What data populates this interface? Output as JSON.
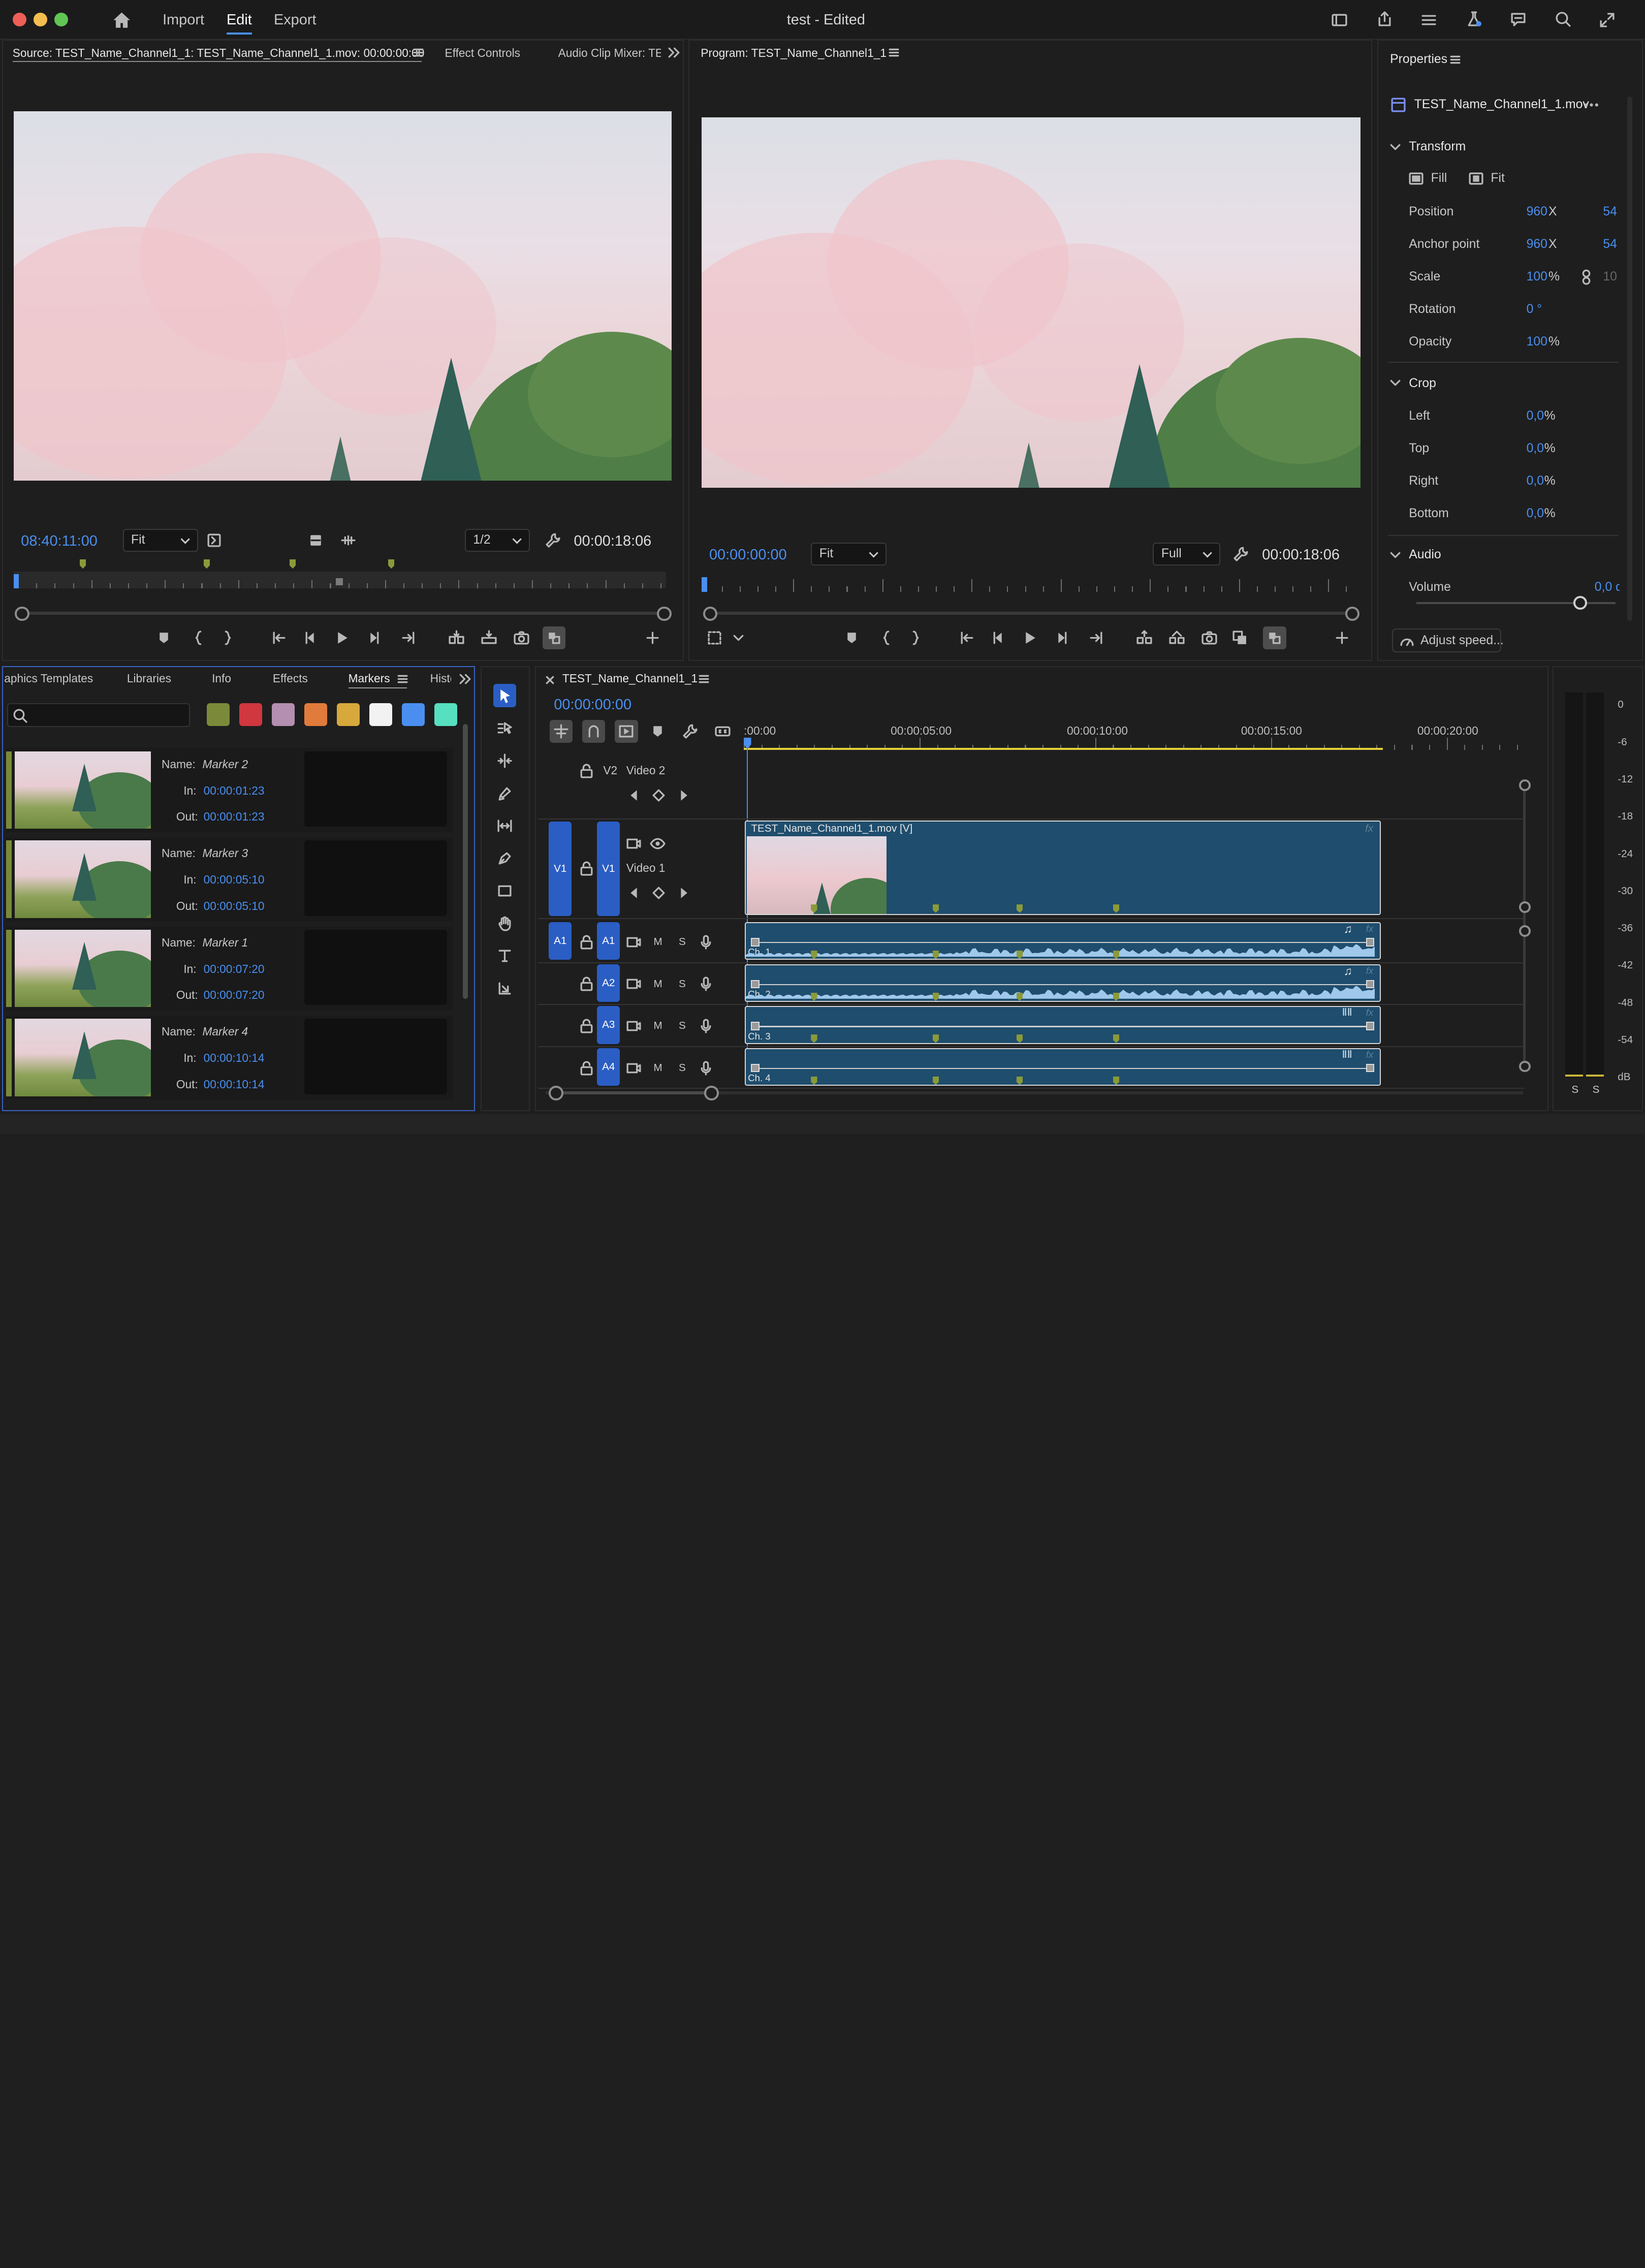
{
  "titlebar": {
    "menu": [
      "Import",
      "Edit",
      "Export"
    ],
    "active_menu": "Edit",
    "title": "test - Edited"
  },
  "source": {
    "tab_label": "Source: TEST_Name_Channel1_1: TEST_Name_Channel1_1.mov: 00:00:00:00",
    "tab2": "Effect Controls",
    "tab3": "Audio Clip Mixer: TE:",
    "timecode": "08:40:11:00",
    "fit": "Fit",
    "resolution": "1/2",
    "duration": "00:00:18:06"
  },
  "program": {
    "tab_label": "Program: TEST_Name_Channel1_1",
    "timecode": "00:00:00:00",
    "fit": "Fit",
    "resolution": "Full",
    "duration": "00:00:18:06"
  },
  "properties": {
    "title": "Properties",
    "clip": "TEST_Name_Channel1_1.mov",
    "transform": "Transform",
    "fill": "Fill",
    "fit": "Fit",
    "position": {
      "label": "Position",
      "x": "960",
      "xu": "X",
      "y": "54("
    },
    "anchor": {
      "label": "Anchor point",
      "x": "960",
      "xu": "X",
      "y": "54("
    },
    "scale": {
      "label": "Scale",
      "v": "100",
      "u": "%",
      "v2": "10("
    },
    "rotation": {
      "label": "Rotation",
      "v": "0 °"
    },
    "opacity": {
      "label": "Opacity",
      "v": "100",
      "u": "%"
    },
    "crop": "Crop",
    "left": {
      "label": "Left",
      "v": "0,0",
      "u": "%"
    },
    "top": {
      "label": "Top",
      "v": "0,0",
      "u": "%"
    },
    "right": {
      "label": "Right",
      "v": "0,0",
      "u": "%"
    },
    "bottom": {
      "label": "Bottom",
      "v": "0,0",
      "u": "%"
    },
    "audio": "Audio",
    "volume": {
      "label": "Volume",
      "v": "0,0 d",
      "level": 0.82
    },
    "adjust_speed": "Adjust speed..."
  },
  "panels": {
    "tabs": [
      "aphics Templates",
      "Libraries",
      "Info",
      "Effects",
      "Markers",
      "Histo"
    ],
    "active": "Markers"
  },
  "markers": {
    "labels": {
      "name": "Name:",
      "in": "In:",
      "out": "Out:"
    },
    "colors": [
      "#7a8a3a",
      "#d0373f",
      "#b48fb0",
      "#e17b3b",
      "#d7a83b",
      "#f2f2f2",
      "#4a8ff0",
      "#57e0c0"
    ],
    "items": [
      {
        "name": "Marker 2",
        "in": "00:00:01:23",
        "out": "00:00:01:23"
      },
      {
        "name": "Marker 3",
        "in": "00:00:05:10",
        "out": "00:00:05:10"
      },
      {
        "name": "Marker 1",
        "in": "00:00:07:20",
        "out": "00:00:07:20"
      },
      {
        "name": "Marker 4",
        "in": "00:00:10:14",
        "out": "00:00:10:14"
      }
    ]
  },
  "timeline": {
    "tab": "TEST_Name_Channel1_1",
    "timecode": "00:00:00:00",
    "ruler": [
      ":00:00",
      "00:00:05:00",
      "00:00:10:00",
      "00:00:15:00",
      "00:00:20:00"
    ],
    "tracks": {
      "v2": {
        "id": "V2",
        "name": "Video 2"
      },
      "v1": {
        "id": "V1",
        "src": "V1",
        "name": "Video 1"
      },
      "a1": {
        "src": "A1",
        "id": "A1"
      },
      "a2": "A2",
      "a3": "A3",
      "a4": "A4",
      "m": "M",
      "s": "S"
    },
    "clip_name": "TEST_Name_Channel1_1.mov [V]",
    "channels": [
      "Ch. 1",
      "Ch. 2",
      "Ch. 3",
      "Ch. 4"
    ]
  },
  "meter": {
    "scale": [
      "0",
      "-6",
      "-12",
      "-18",
      "-24",
      "-30",
      "-36",
      "-42",
      "-48",
      "-54",
      "dB"
    ],
    "solo": [
      "S",
      "S"
    ]
  }
}
